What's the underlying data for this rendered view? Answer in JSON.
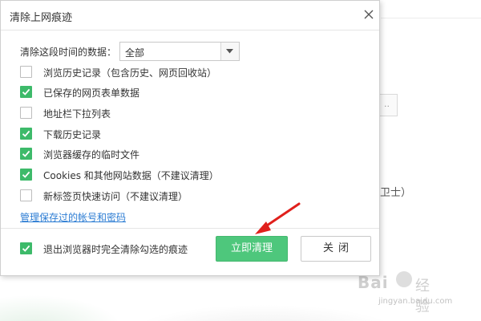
{
  "background": {
    "text_fragment": "卫士）",
    "button_fragment": "..",
    "watermark": {
      "brand_part1": "Bai",
      "brand_part2": "经验",
      "sub": "jingyan.baidu.com"
    }
  },
  "dialog": {
    "title": "清除上网痕迹",
    "range_label": "清除这段时间的数据：",
    "range_value": "全部",
    "options": [
      {
        "label": "浏览历史记录（包含历史、网页回收站）",
        "checked": false
      },
      {
        "label": "已保存的网页表单数据",
        "checked": true
      },
      {
        "label": "地址栏下拉列表",
        "checked": false
      },
      {
        "label": "下载历史记录",
        "checked": true
      },
      {
        "label": "浏览器缓存的临时文件",
        "checked": true
      },
      {
        "label": "Cookies 和其他网站数据（不建议清理）",
        "checked": true
      },
      {
        "label": "新标签页快速访问（不建议清理）",
        "checked": false
      }
    ],
    "manage_link": "管理保存过的帐号和密码",
    "exit_option": {
      "label": "退出浏览器时完全清除勾选的痕迹",
      "checked": true
    },
    "clear_button": "立即清理",
    "close_button": "关闭"
  },
  "colors": {
    "accent_green": "#4ec77c",
    "checkbox_green": "#3dba6a",
    "link_blue": "#2b7cd3",
    "annotation_red": "#e0201c"
  }
}
